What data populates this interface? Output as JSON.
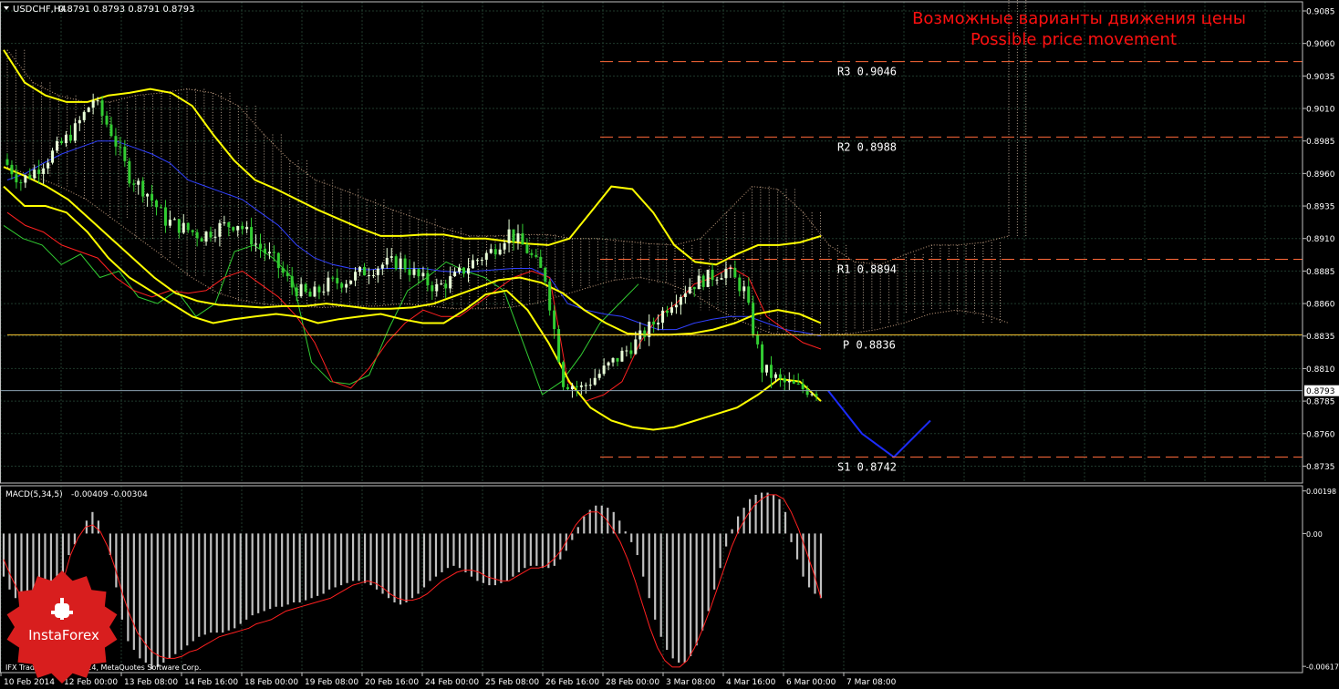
{
  "window": {
    "title": "USDCHF,H4",
    "ohlc": "0.8791 0.8793 0.8791 0.8793"
  },
  "annotation": {
    "line_ru": "Возможные варианты движения цены",
    "line_en": "Possible price movement",
    "color": "#ff1010"
  },
  "footer": {
    "copyright": "IFX Trader, © 2001-2014, MetaQuotes Software Corp."
  },
  "brand": {
    "name": "InstaForex",
    "color": "#d81e1e"
  },
  "colors": {
    "grid": "#1f3a2c",
    "bull": "#e8ffd8",
    "bear": "#32cd32",
    "bollinger": "#ffff00",
    "tenkan": "#ff2020",
    "kijun": "#3040ff",
    "chikou": "#32cd32",
    "pivot_line": "#ff6a3a",
    "p_line": "#ffcc33",
    "forecast": "#1c2cff",
    "macd_hist": "#c0c0c0",
    "macd_signal": "#ff2020"
  },
  "chart_data": [
    {
      "type": "line",
      "symbol": "USDCHF,H4",
      "ylim": [
        0.8722,
        0.9092
      ],
      "grid": true,
      "y_ticks": [
        "0.9085",
        "0.9060",
        "0.9035",
        "0.9010",
        "0.8985",
        "0.8960",
        "0.8935",
        "0.8910",
        "0.8885",
        "0.8860",
        "0.8835",
        "0.8810",
        "0.8785",
        "0.8760",
        "0.8735"
      ],
      "x_ticks": [
        "10 Feb 2014",
        "12 Feb 00:00",
        "13 Feb 08:00",
        "14 Feb 16:00",
        "18 Feb 00:00",
        "19 Feb 08:00",
        "20 Feb 16:00",
        "24 Feb 00:00",
        "25 Feb 08:00",
        "26 Feb 16:00",
        "28 Feb 00:00",
        "3 Mar 08:00",
        "4 Mar 16:00",
        "6 Mar 00:00",
        "7 Mar 08:00"
      ],
      "current_price": "0.8793",
      "levels": [
        {
          "label": "R3",
          "value": "0.9046"
        },
        {
          "label": "R2",
          "value": "0.8988"
        },
        {
          "label": "R1",
          "value": "0.8894"
        },
        {
          "label": "P",
          "value": "0.8836"
        },
        {
          "label": "S1",
          "value": "0.8742"
        }
      ],
      "series": [
        {
          "values": [
            0.8971,
            0.8954,
            0.8965,
            0.8979,
            0.8994,
            0.9017,
            0.8992,
            0.8958,
            0.8945,
            0.8924,
            0.8918,
            0.8912,
            0.8919,
            0.8922,
            0.8906,
            0.8893,
            0.8873,
            0.8865,
            0.8875,
            0.8878,
            0.8885,
            0.889,
            0.8892,
            0.888,
            0.8872,
            0.888,
            0.8892,
            0.89,
            0.8915,
            0.8901,
            0.888,
            0.88,
            0.8795,
            0.8806,
            0.8818,
            0.883,
            0.8845,
            0.8862,
            0.8874,
            0.888,
            0.8886,
            0.887,
            0.881,
            0.88,
            0.8795,
            0.8793
          ]
        },
        {
          "values": [
            0.896,
            0.897,
            0.8975,
            0.898,
            0.899,
            0.9,
            0.8995,
            0.896,
            0.8945,
            0.8935,
            0.893,
            0.8925,
            0.892,
            0.8915,
            0.8905,
            0.8895,
            0.8885,
            0.888,
            0.8872,
            0.887,
            0.8872,
            0.8878,
            0.888,
            0.8876,
            0.8872,
            0.8872,
            0.8876,
            0.8888,
            0.8895,
            0.8895,
            0.888,
            0.883,
            0.8815,
            0.881,
            0.881,
            0.882,
            0.883,
            0.884,
            0.8855,
            0.8862,
            0.887,
            0.886,
            0.884,
            0.883,
            0.881,
            0.88
          ]
        },
        {
          "values": [
            0.8955,
            0.896,
            0.8968,
            0.8975,
            0.898,
            0.8985,
            0.8985,
            0.898,
            0.8975,
            0.8968,
            0.8955,
            0.895,
            0.8945,
            0.894,
            0.893,
            0.892,
            0.8905,
            0.8895,
            0.889,
            0.8887,
            0.8886,
            0.8887,
            0.8887,
            0.8887,
            0.8885,
            0.8884,
            0.8885,
            0.8886,
            0.8887,
            0.8887,
            0.888,
            0.886,
            0.8855,
            0.8852,
            0.885,
            0.8845,
            0.884,
            0.884,
            0.8845,
            0.8848,
            0.885,
            0.885,
            0.8845,
            0.884,
            0.8838,
            0.8835
          ]
        },
        {
          "values": [
            0.893,
            0.892,
            0.8915,
            0.8905,
            0.89,
            0.8895,
            0.888,
            0.887,
            0.8865,
            0.887,
            0.8868,
            0.887,
            0.888,
            0.8885,
            0.8875,
            0.8865,
            0.885,
            0.883,
            0.88,
            0.8795,
            0.881,
            0.883,
            0.8845,
            0.8855,
            0.885,
            0.885,
            0.886,
            0.887,
            0.888,
            0.8885,
            0.888,
            0.88,
            0.8785,
            0.879,
            0.88,
            0.883,
            0.885,
            0.886,
            0.8875,
            0.888,
            0.8888,
            0.888,
            0.885,
            0.884,
            0.883,
            0.8825
          ]
        },
        {
          "values": [
            0.9055,
            0.903,
            0.902,
            0.9015,
            0.9015,
            0.902,
            0.9022,
            0.9025,
            0.9022,
            0.9012,
            0.899,
            0.897,
            0.8955,
            0.8948,
            0.894,
            0.8932,
            0.8925,
            0.8918,
            0.8912,
            0.8912,
            0.8913,
            0.8913,
            0.891,
            0.891,
            0.8908,
            0.8906,
            0.8905,
            0.891,
            0.893,
            0.895,
            0.8948,
            0.893,
            0.8905,
            0.8892,
            0.889,
            0.8898,
            0.8905,
            0.8905,
            0.8907,
            0.8912
          ]
        },
        {
          "values": [
            0.8965,
            0.8958,
            0.895,
            0.894,
            0.8925,
            0.891,
            0.8895,
            0.888,
            0.8868,
            0.8862,
            0.8859,
            0.8858,
            0.8857,
            0.8858,
            0.8858,
            0.886,
            0.8858,
            0.8856,
            0.8856,
            0.8857,
            0.886,
            0.8866,
            0.8872,
            0.8878,
            0.888,
            0.8876,
            0.8868,
            0.8855,
            0.8845,
            0.8837,
            0.8836,
            0.8836,
            0.8837,
            0.884,
            0.8845,
            0.8852,
            0.8855,
            0.8852,
            0.8845
          ]
        },
        {
          "values": [
            0.895,
            0.8935,
            0.8935,
            0.893,
            0.8915,
            0.8895,
            0.888,
            0.887,
            0.886,
            0.885,
            0.8845,
            0.8848,
            0.885,
            0.8852,
            0.885,
            0.8845,
            0.8848,
            0.885,
            0.8852,
            0.8848,
            0.8845,
            0.8845,
            0.8855,
            0.8867,
            0.887,
            0.8855,
            0.883,
            0.88,
            0.878,
            0.877,
            0.8765,
            0.8763,
            0.8765,
            0.877,
            0.8775,
            0.878,
            0.879,
            0.8802,
            0.88,
            0.8785
          ]
        },
        {
          "values": [
            0.892,
            0.891,
            0.8905,
            0.889,
            0.8898,
            0.888,
            0.8885,
            0.8865,
            0.886,
            0.887,
            0.885,
            0.886,
            0.89,
            0.8905,
            0.8895,
            0.888,
            0.8815,
            0.88,
            0.8798,
            0.8805,
            0.884,
            0.887,
            0.888,
            0.8892,
            0.8885,
            0.888,
            0.887,
            0.883,
            0.879,
            0.88,
            0.882,
            0.8845,
            0.886,
            0.8875
          ]
        },
        {
          "values": [
            0.8793,
            0.876,
            0.8742,
            0.877
          ]
        }
      ]
    },
    {
      "type": "bar",
      "indicator": "MACD(5,34,5)",
      "readout": "-0.00409 -0.00304",
      "ylim": [
        -0.00646,
        0.00222
      ],
      "y_ticks": [
        "0.00198",
        "0.00",
        "-0.00617"
      ],
      "series": [
        {
          "values": [
            -0.002,
            -0.0026,
            -0.003,
            -0.0033,
            -0.0036,
            -0.0038,
            -0.004,
            -0.0041,
            -0.0038,
            -0.003,
            -0.002,
            -0.001,
            -0.0005,
            0.0,
            0.0006,
            0.001,
            0.0006,
            0.0,
            -0.001,
            -0.0025,
            -0.004,
            -0.005,
            -0.0054,
            -0.0058,
            -0.006,
            -0.0063,
            -0.0062,
            -0.006,
            -0.0058,
            -0.0056,
            -0.0054,
            -0.0052,
            -0.005,
            -0.0048,
            -0.0047,
            -0.0046,
            -0.0046,
            -0.0046,
            -0.0045,
            -0.0044,
            -0.0042,
            -0.004,
            -0.0038,
            -0.0037,
            -0.0036,
            -0.0035,
            -0.0034,
            -0.0034,
            -0.0033,
            -0.0032,
            -0.0032,
            -0.0031,
            -0.003,
            -0.0029,
            -0.0028,
            -0.0026,
            -0.0025,
            -0.0024,
            -0.0023,
            -0.0022,
            -0.0022,
            -0.0023,
            -0.0024,
            -0.0026,
            -0.0028,
            -0.003,
            -0.0032,
            -0.0033,
            -0.0032,
            -0.003,
            -0.0028,
            -0.0025,
            -0.0022,
            -0.002,
            -0.0018,
            -0.0016,
            -0.0015,
            -0.0016,
            -0.0018,
            -0.002,
            -0.0022,
            -0.0023,
            -0.0024,
            -0.0024,
            -0.0023,
            -0.0022,
            -0.002,
            -0.0018,
            -0.0016,
            -0.0015,
            -0.0015,
            -0.0016,
            -0.0016,
            -0.0015,
            -0.0012,
            -0.0008,
            -0.0003,
            0.0003,
            0.0008,
            0.0011,
            0.0013,
            0.0013,
            0.0012,
            0.001,
            0.0006,
            0.0001,
            -0.0004,
            -0.001,
            -0.002,
            -0.003,
            -0.004,
            -0.0048,
            -0.0054,
            -0.0058,
            -0.006,
            -0.006,
            -0.0057,
            -0.0052,
            -0.0045,
            -0.0036,
            -0.0026,
            -0.0016,
            -0.0006,
            0.0002,
            0.0008,
            0.0012,
            0.0016,
            0.0018,
            0.0019,
            0.0019,
            0.0018,
            0.0016,
            0.001,
            -0.0004,
            -0.0012,
            -0.002,
            -0.0025,
            -0.0028,
            -0.003
          ]
        },
        {
          "values": [
            -0.0012,
            -0.002,
            -0.0027,
            -0.0032,
            -0.0036,
            -0.0038,
            -0.0037,
            -0.0032,
            -0.0022,
            -0.001,
            -0.0002,
            0.0003,
            0.0004,
            0.0001,
            -0.0006,
            -0.0016,
            -0.0028,
            -0.0038,
            -0.0046,
            -0.0051,
            -0.0055,
            -0.0057,
            -0.0058,
            -0.0058,
            -0.0057,
            -0.0055,
            -0.0054,
            -0.0052,
            -0.005,
            -0.0048,
            -0.0047,
            -0.0046,
            -0.0045,
            -0.0044,
            -0.0042,
            -0.0041,
            -0.004,
            -0.0038,
            -0.0036,
            -0.0035,
            -0.0034,
            -0.0033,
            -0.0032,
            -0.0031,
            -0.003,
            -0.0028,
            -0.0026,
            -0.0024,
            -0.0023,
            -0.0022,
            -0.0023,
            -0.0025,
            -0.0028,
            -0.003,
            -0.0031,
            -0.0031,
            -0.003,
            -0.0028,
            -0.0025,
            -0.0022,
            -0.002,
            -0.0018,
            -0.0017,
            -0.0017,
            -0.0018,
            -0.002,
            -0.0021,
            -0.0022,
            -0.0022,
            -0.002,
            -0.0018,
            -0.0016,
            -0.0016,
            -0.0015,
            -0.0012,
            -0.0008,
            -0.0002,
            0.0004,
            0.0008,
            0.001,
            0.001,
            0.0007,
            0.0002,
            -0.0004,
            -0.0012,
            -0.0022,
            -0.0033,
            -0.0044,
            -0.0053,
            -0.0059,
            -0.0062,
            -0.0062,
            -0.0059,
            -0.0053,
            -0.0045,
            -0.0036,
            -0.0026,
            -0.0016,
            -0.0006,
            0.0002,
            0.0008,
            0.0013,
            0.0016,
            0.0018,
            0.0018,
            0.0016,
            0.001,
            0.0002,
            -0.0008,
            -0.0018,
            -0.003
          ]
        }
      ]
    }
  ]
}
